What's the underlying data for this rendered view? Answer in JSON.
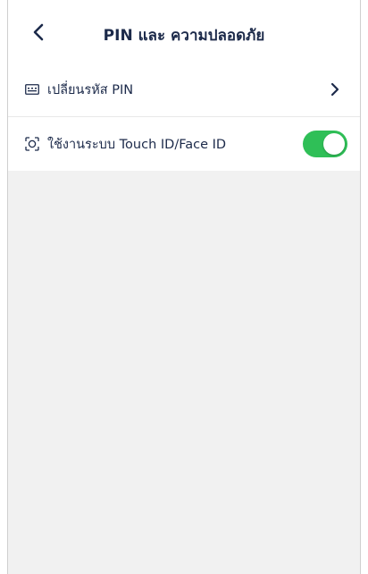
{
  "header": {
    "title": "PIN และ ความปลอดภัย",
    "back_icon": "chevron-left-icon"
  },
  "settings": [
    {
      "icon": "keypad-icon",
      "label": "เปลี่ยนรหัส PIN",
      "trailing": "chevron-right-icon"
    },
    {
      "icon": "face-scan-icon",
      "label": "ใช้งานระบบ Touch ID/Face ID",
      "trailing": "toggle",
      "toggle_on": true
    }
  ],
  "colors": {
    "toggle_on": "#2fbf57",
    "text": "#1c2a4a",
    "background": "#f1f1f1"
  }
}
